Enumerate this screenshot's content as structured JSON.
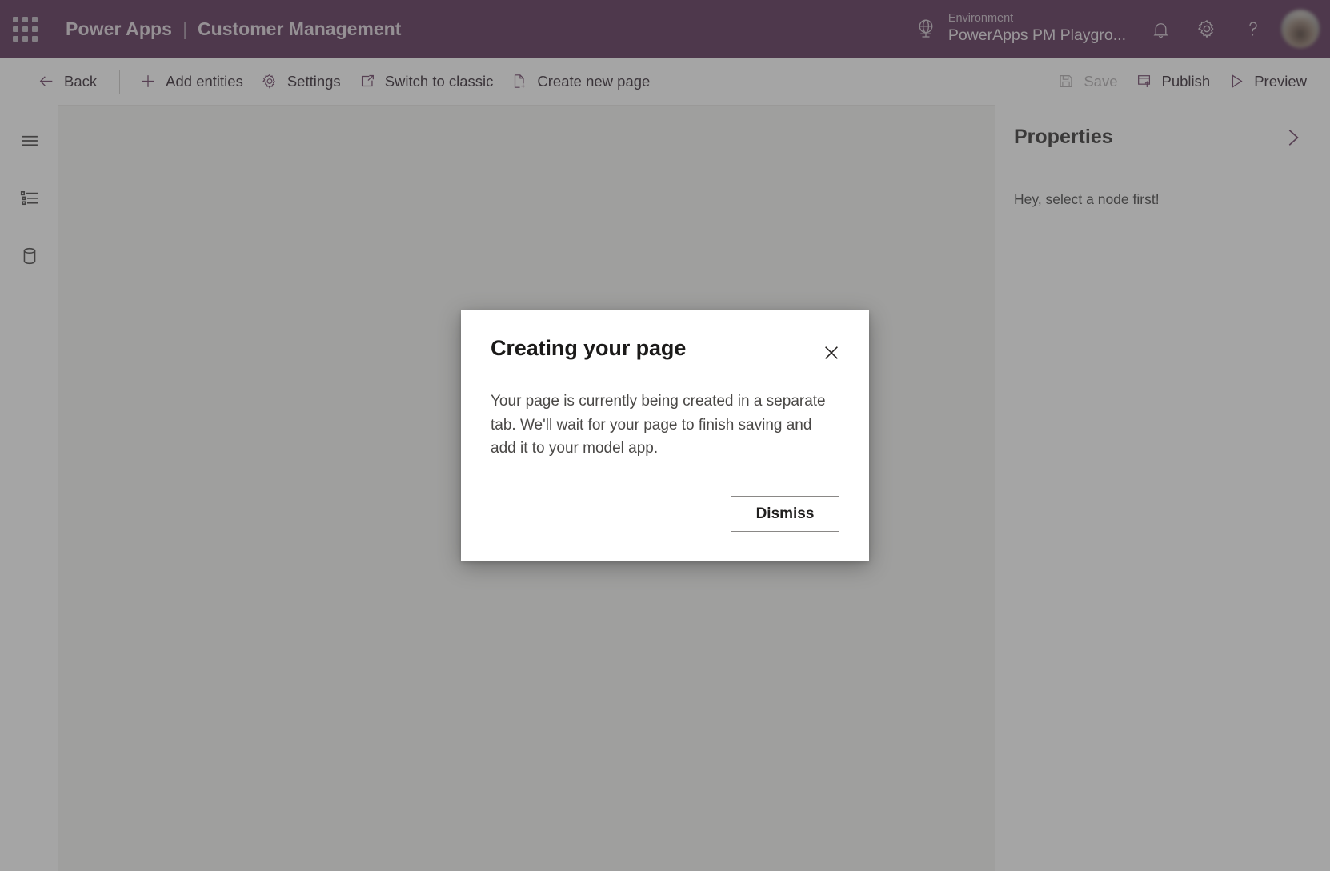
{
  "header": {
    "app_launcher_icon": "waffle-grid-icon",
    "brand_name": "Power Apps",
    "brand_separator": "|",
    "app_title": "Customer Management",
    "environment_label": "Environment",
    "environment_value": "PowerApps PM Playgro...",
    "environment_icon": "globe-icon",
    "notification_icon": "bell-icon",
    "settings_icon": "gear-icon",
    "help_icon": "question-mark-icon",
    "avatar_name": "user-avatar",
    "background_color": "#4a1c45"
  },
  "command_bar": {
    "items": [
      {
        "label": "Back",
        "icon": "arrow-left-icon",
        "disabled": false
      },
      {
        "label": "Add entities",
        "icon": "plus-icon",
        "disabled": false
      },
      {
        "label": "Settings",
        "icon": "gear-icon",
        "disabled": false
      },
      {
        "label": "Switch to classic",
        "icon": "open-in-new-icon",
        "disabled": false
      },
      {
        "label": "Create new page",
        "icon": "page-add-icon",
        "disabled": false
      }
    ],
    "right_items": [
      {
        "label": "Save",
        "icon": "save-icon",
        "disabled": true
      },
      {
        "label": "Publish",
        "icon": "publish-icon",
        "disabled": false
      },
      {
        "label": "Preview",
        "icon": "play-triangle-icon",
        "disabled": false
      }
    ],
    "accent_color": "#5c2d55",
    "disabled_color": "#a9a6a8"
  },
  "left_rail": {
    "items": [
      {
        "name": "hamburger-menu",
        "icon": "hamburger-icon"
      },
      {
        "name": "navigation-list",
        "icon": "list-bullets-icon"
      },
      {
        "name": "data-entities",
        "icon": "database-icon"
      }
    ]
  },
  "properties_panel": {
    "title": "Properties",
    "collapse_icon": "chevron-right-icon",
    "empty_message": "Hey, select a node first!"
  },
  "modal": {
    "title": "Creating your page",
    "body": "Your page is currently being created in a separate tab. We'll wait for your page to finish saving and add it to your model app.",
    "close_icon": "close-x-icon",
    "primary_button": "Dismiss"
  }
}
